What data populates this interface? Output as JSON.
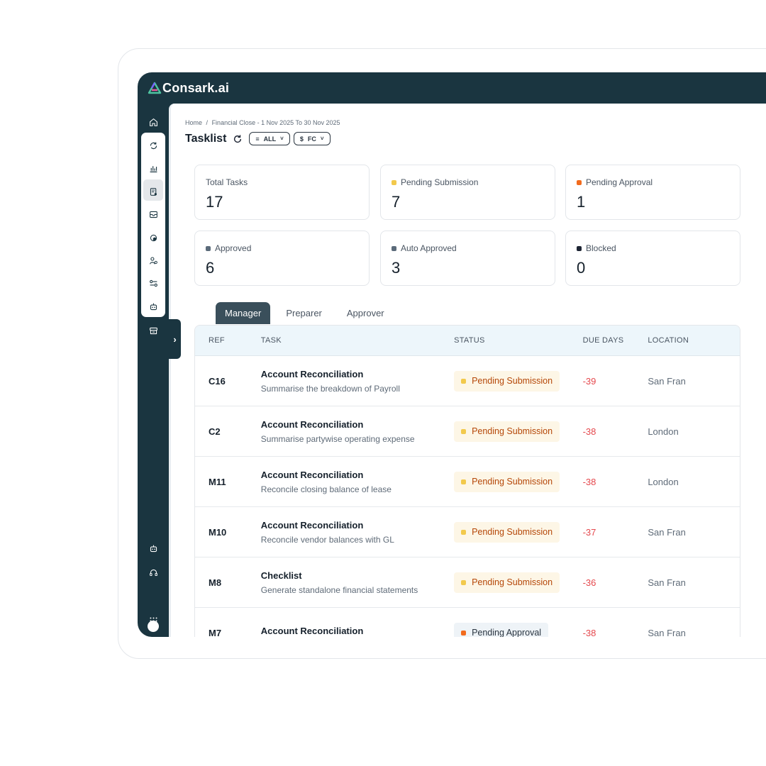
{
  "app": {
    "name": "Consark.ai"
  },
  "breadcrumb": {
    "home": "Home",
    "separator": "/",
    "current": "Financial Close - 1 Nov 2025 To 30 Nov 2025"
  },
  "page": {
    "title": "Tasklist"
  },
  "filters": {
    "view": "ALL",
    "currency": "FC"
  },
  "summary": [
    {
      "label": "Total Tasks",
      "value": "17",
      "color": ""
    },
    {
      "label": "Pending Submission",
      "value": "7",
      "color": "#f2c94c"
    },
    {
      "label": "Pending Approval",
      "value": "1",
      "color": "#f26b1d"
    },
    {
      "label": "Approved",
      "value": "6",
      "color": "#5b6b7a"
    },
    {
      "label": "Auto Approved",
      "value": "3",
      "color": "#5b6b7a"
    },
    {
      "label": "Blocked",
      "value": "0",
      "color": "#1d2433"
    }
  ],
  "tabs": [
    {
      "label": "Manager",
      "active": true
    },
    {
      "label": "Preparer",
      "active": false
    },
    {
      "label": "Approver",
      "active": false
    }
  ],
  "table": {
    "columns": [
      "REF",
      "TASK",
      "STATUS",
      "DUE DAYS",
      "LOCATION"
    ],
    "rows": [
      {
        "ref": "C16",
        "task": "Account Reconciliation",
        "desc": "Summarise the breakdown of Payroll",
        "status": "Pending Submission",
        "due": "-39",
        "location": "San Fran"
      },
      {
        "ref": "C2",
        "task": "Account Reconciliation",
        "desc": "Summarise partywise operating expense",
        "status": "Pending Submission",
        "due": "-38",
        "location": "London"
      },
      {
        "ref": "M11",
        "task": "Account Reconciliation",
        "desc": "Reconcile closing balance of lease",
        "status": "Pending Submission",
        "due": "-38",
        "location": "London"
      },
      {
        "ref": "M10",
        "task": "Account Reconciliation",
        "desc": "Reconcile vendor balances with GL",
        "status": "Pending Submission",
        "due": "-37",
        "location": "San Fran"
      },
      {
        "ref": "M8",
        "task": "Checklist",
        "desc": "Generate standalone financial statements",
        "status": "Pending Submission",
        "due": "-36",
        "location": "San Fran"
      },
      {
        "ref": "M7",
        "task": "Account Reconciliation",
        "desc": "",
        "status": "Pending Approval",
        "due": "-38",
        "location": "San Fran"
      }
    ]
  },
  "sidebar": {
    "icons": [
      "home-icon",
      "sync-icon",
      "chart-icon",
      "task-doc-icon",
      "inbox-icon",
      "finance-icon",
      "users-icon",
      "settings-flow-icon",
      "bot-icon",
      "archive-icon"
    ],
    "bottom_icons": [
      "bot-icon",
      "support-icon",
      "avatar",
      "apps-grid-icon"
    ]
  }
}
